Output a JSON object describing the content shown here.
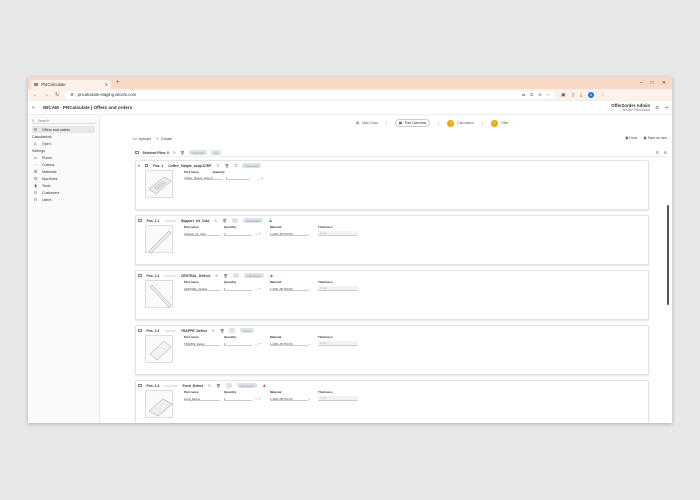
{
  "browser": {
    "tab_title": "PNCalculate",
    "tab_logo": "W",
    "new_tab": "+",
    "url": "pncalculate-staging.wicam.com",
    "profile_initial": "A"
  },
  "app": {
    "title": "WICAM · PNCalculate | Offers and orders",
    "user_name": "Offer2order Admin",
    "user_sub": "WICAM Offer2order"
  },
  "sidebar": {
    "search": "Search",
    "top_item": "Offers and orders",
    "calc_header": "Calculations",
    "calc_items": [
      "Open"
    ],
    "settings_header": "Settings",
    "settings_items": [
      "Prices",
      "Cuttons",
      "Materials",
      "Machines",
      "Tools",
      "Customers",
      "Users"
    ]
  },
  "stepper": {
    "steps": [
      {
        "label": "Main Data",
        "badge": ""
      },
      {
        "label": "Part Overview",
        "badge": ""
      },
      {
        "label": "Calculation",
        "badge": "3"
      },
      {
        "label": "Offer",
        "badge": "4"
      }
    ]
  },
  "actions": {
    "upload": "Upload",
    "create": "Create",
    "done": "Done",
    "save_as_new": "Save as new"
  },
  "selection": {
    "label": "Selected Files: 0",
    "chips": [
      "Calculate",
      "Go"
    ]
  },
  "positions": [
    {
      "pos": "Pos. 1",
      "dims": "",
      "name": "Coffee_Simple_shop.STEP",
      "status": "",
      "part_name": "Coffee_Simple_shop.0...",
      "quantity": "1",
      "material": "",
      "thickness": "",
      "badge": "Assembly",
      "warn": ""
    },
    {
      "pos": "Pos. 1.1",
      "dims": "100x600",
      "name": "Support_int_Cold",
      "status": "1 x",
      "part_name": "Support_int_Cold",
      "quantity": "4",
      "material": "1.4301 2B X5CrNi",
      "thickness": "1 mm",
      "badge": "Calculated",
      "warn": "ok"
    },
    {
      "pos": "Pos. 1.2",
      "dims": "400x600",
      "name": "CENTRAL_Deflect",
      "status": "1 x",
      "part_name": "CENTRAL_Deflect",
      "quantity": "1",
      "material": "1.4301 2B X5CrNi",
      "thickness": "1 mm",
      "badge": "Calculated",
      "warn": "ok"
    },
    {
      "pos": "Pos. 1.3",
      "dims": "100x200",
      "name": "TRAPPE_Defect",
      "status": "1 x",
      "part_name": "TRAPPE_Defect",
      "quantity": "1",
      "material": "1.4301 2B X5CrNi",
      "thickness": "1 mm",
      "badge": "Done",
      "warn": ""
    },
    {
      "pos": "Pos. 1.4",
      "dims": "800x1080",
      "name": "Fond_Defect",
      "status": "1 x",
      "part_name": "Fond_Defect",
      "quantity": "1",
      "material": "1.4301 2B X5CrNi",
      "thickness": "1 mm",
      "badge": "Calculated",
      "warn": "error"
    }
  ],
  "labels": {
    "part_name": "Part name",
    "quantity": "Quantity",
    "material": "Material",
    "thickness": "Thickness"
  }
}
